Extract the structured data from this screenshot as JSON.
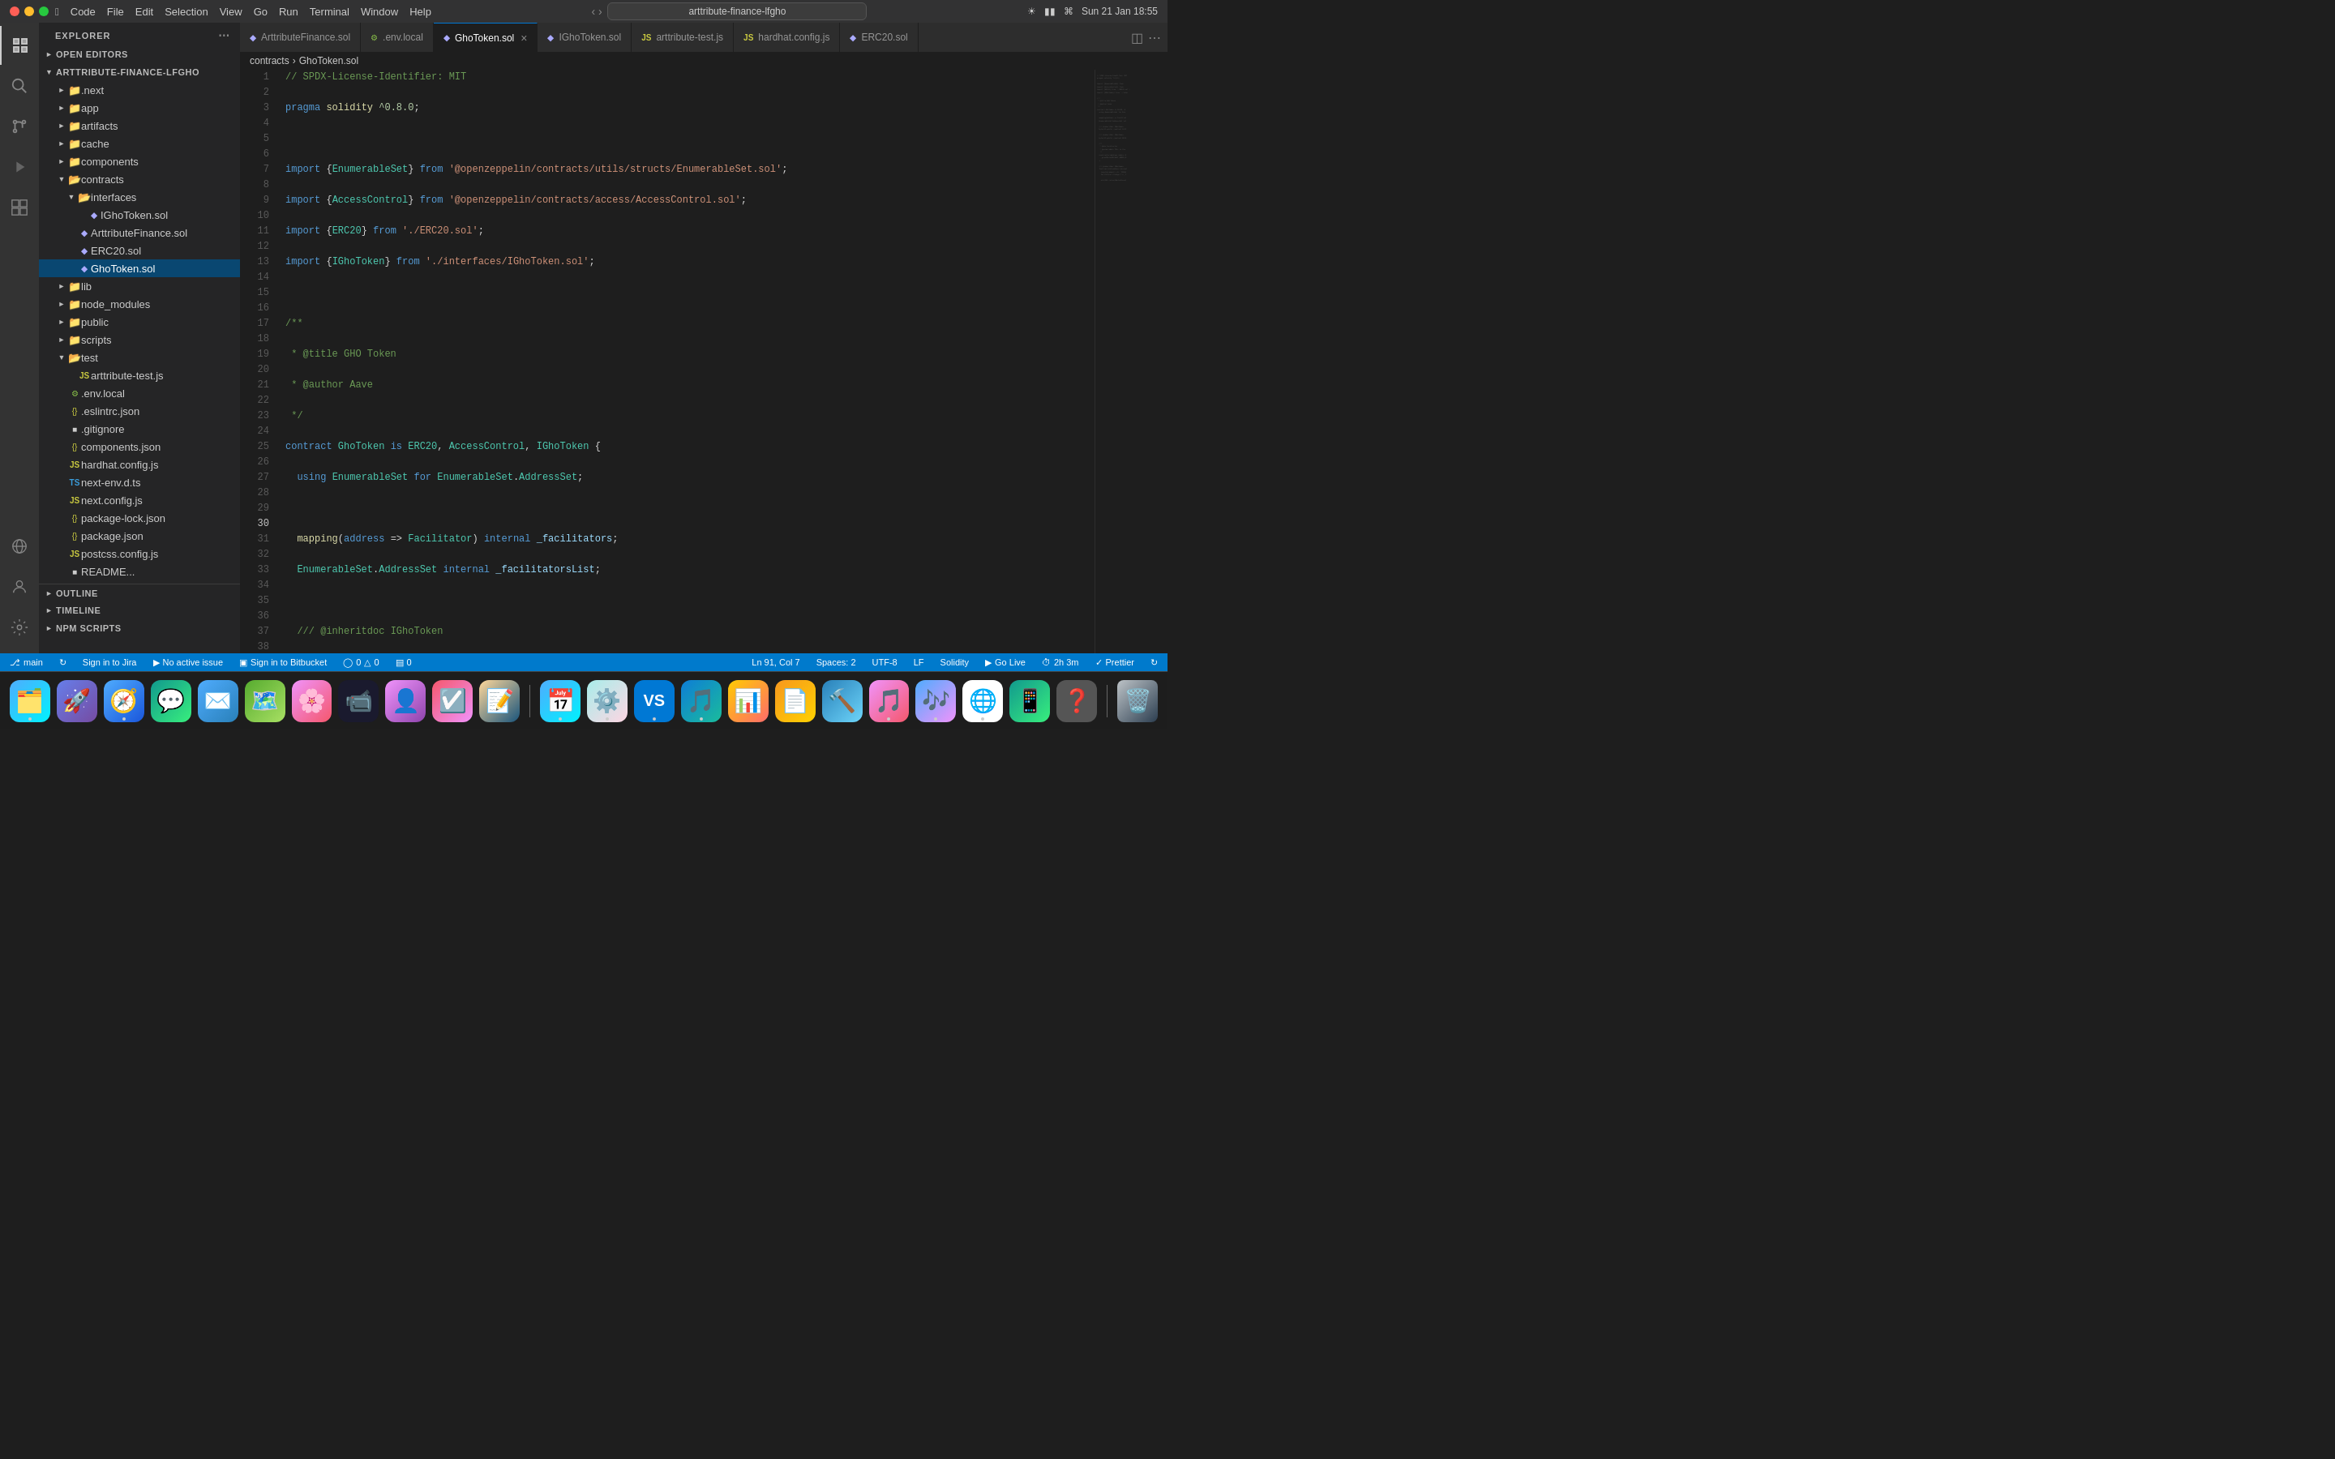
{
  "titlebar": {
    "app_name": "Code",
    "menus": [
      "File",
      "Edit",
      "Selection",
      "View",
      "Go",
      "Run",
      "Terminal",
      "Window",
      "Help"
    ],
    "search_placeholder": "arttribute-finance-lfgho",
    "time": "Sun 21 Jan  18:55"
  },
  "tabs": [
    {
      "id": "artribute",
      "label": "ArttributeFinance.sol",
      "icon": "sol",
      "active": false,
      "closeable": false
    },
    {
      "id": "env",
      "label": ".env.local",
      "icon": "env",
      "active": false,
      "closeable": false
    },
    {
      "id": "ghotoken",
      "label": "GhoToken.sol",
      "icon": "sol",
      "active": true,
      "closeable": true
    },
    {
      "id": "ighotoken",
      "label": "IGhoToken.sol",
      "icon": "sol",
      "active": false,
      "closeable": false
    },
    {
      "id": "arttribute-test",
      "label": "arttribute-test.js",
      "icon": "js",
      "active": false,
      "closeable": false
    },
    {
      "id": "hardhat",
      "label": "hardhat.config.js",
      "icon": "js",
      "active": false,
      "closeable": false
    },
    {
      "id": "erc20",
      "label": "ERC20.sol",
      "icon": "sol",
      "active": false,
      "closeable": false
    }
  ],
  "breadcrumb": {
    "parts": [
      "contracts",
      "GhoToken.sol"
    ]
  },
  "sidebar": {
    "title": "EXPLORER",
    "sections": {
      "open_editors": "OPEN EDITORS",
      "root": "ARTTRIBUTE-FINANCE-LFGHO",
      "outline": "OUTLINE",
      "timeline": "TIMELINE",
      "npm_scripts": "NPM SCRIPTS"
    }
  },
  "file_tree": [
    {
      "indent": 1,
      "type": "folder",
      "name": ".next",
      "open": false
    },
    {
      "indent": 1,
      "type": "folder",
      "name": "app",
      "open": false
    },
    {
      "indent": 1,
      "type": "folder",
      "name": "artifacts",
      "open": false
    },
    {
      "indent": 1,
      "type": "folder",
      "name": "cache",
      "open": false
    },
    {
      "indent": 1,
      "type": "folder",
      "name": "components",
      "open": false
    },
    {
      "indent": 1,
      "type": "folder",
      "name": "contracts",
      "open": true
    },
    {
      "indent": 2,
      "type": "folder",
      "name": "interfaces",
      "open": true
    },
    {
      "indent": 3,
      "type": "file-sol",
      "name": "IGhoToken.sol"
    },
    {
      "indent": 3,
      "type": "file-sol",
      "name": "ArttributeFinance.sol"
    },
    {
      "indent": 3,
      "type": "file-sol",
      "name": "ERC20.sol"
    },
    {
      "indent": 3,
      "type": "file-sol",
      "name": "GhoToken.sol",
      "active": true
    },
    {
      "indent": 1,
      "type": "folder",
      "name": "lib",
      "open": false
    },
    {
      "indent": 1,
      "type": "folder",
      "name": "node_modules",
      "open": false
    },
    {
      "indent": 1,
      "type": "folder",
      "name": "public",
      "open": false
    },
    {
      "indent": 1,
      "type": "folder",
      "name": "scripts",
      "open": false
    },
    {
      "indent": 1,
      "type": "folder",
      "name": "test",
      "open": true
    },
    {
      "indent": 2,
      "type": "file-js",
      "name": "arttribute-test.js"
    },
    {
      "indent": 1,
      "type": "file-env",
      "name": ".env.local"
    },
    {
      "indent": 1,
      "type": "file-txt",
      "name": ".eslintrc.json"
    },
    {
      "indent": 1,
      "type": "file-json",
      "name": ".gitignore"
    },
    {
      "indent": 1,
      "type": "file-json",
      "name": "components.json"
    },
    {
      "indent": 1,
      "type": "file-js",
      "name": "hardhat.config.js"
    },
    {
      "indent": 1,
      "type": "file-ts",
      "name": "next-env.d.ts"
    },
    {
      "indent": 1,
      "type": "file-js",
      "name": "next.config.js"
    },
    {
      "indent": 1,
      "type": "file-json",
      "name": "package-lock.json"
    },
    {
      "indent": 1,
      "type": "file-json",
      "name": "package.json"
    },
    {
      "indent": 1,
      "type": "file-js",
      "name": "postcss.config.js"
    },
    {
      "indent": 1,
      "type": "file-txt",
      "name": "README..."
    }
  ],
  "editor": {
    "filename": "GhoToken.sol"
  },
  "status_bar": {
    "branch": "main",
    "sign_in_jira": "Sign in to Jira",
    "no_active_issue": "No active issue",
    "sign_in_bitbucket": "Sign in to Bitbucket",
    "errors": "0",
    "warnings": "0",
    "info": "0",
    "position": "Ln 91, Col 7",
    "spaces": "Spaces: 2",
    "encoding": "UTF-8",
    "line_ending": "LF",
    "language": "Solidity",
    "go_live": "Go Live",
    "time_ago": "2h 3m",
    "formatter": "Prettier"
  },
  "dock_apps": [
    {
      "name": "finder",
      "emoji": "🗂️",
      "color": "#1e7ce8"
    },
    {
      "name": "launchpad",
      "emoji": "🚀",
      "color": "#555"
    },
    {
      "name": "safari",
      "emoji": "🧭",
      "color": "#555"
    },
    {
      "name": "messages",
      "emoji": "💬",
      "color": "#555"
    },
    {
      "name": "mail",
      "emoji": "✉️",
      "color": "#555"
    },
    {
      "name": "maps",
      "emoji": "🗺️",
      "color": "#555"
    },
    {
      "name": "photos",
      "emoji": "🌸",
      "color": "#555"
    },
    {
      "name": "facetime",
      "emoji": "📹",
      "color": "#555"
    },
    {
      "name": "contacts",
      "emoji": "👤",
      "color": "#555"
    },
    {
      "name": "reminders",
      "emoji": "☑️",
      "color": "#555"
    },
    {
      "name": "notes",
      "emoji": "📝",
      "color": "#555"
    },
    {
      "name": "system-prefs",
      "emoji": "⚙️",
      "color": "#555"
    },
    {
      "name": "vscode",
      "emoji": "🔵",
      "color": "#555"
    },
    {
      "name": "numbers",
      "emoji": "📊",
      "color": "#555"
    },
    {
      "name": "pages",
      "emoji": "📄",
      "color": "#555"
    },
    {
      "name": "xcode",
      "emoji": "🔨",
      "color": "#555"
    },
    {
      "name": "music",
      "emoji": "🎵",
      "color": "#555"
    },
    {
      "name": "itunes",
      "emoji": "🎵",
      "color": "#555"
    },
    {
      "name": "chrome",
      "emoji": "🌐",
      "color": "#555"
    },
    {
      "name": "whatsapp",
      "emoji": "💚",
      "color": "#555"
    },
    {
      "name": "help",
      "emoji": "❓",
      "color": "#555"
    },
    {
      "name": "trash",
      "emoji": "🗑️",
      "color": "#555"
    }
  ]
}
